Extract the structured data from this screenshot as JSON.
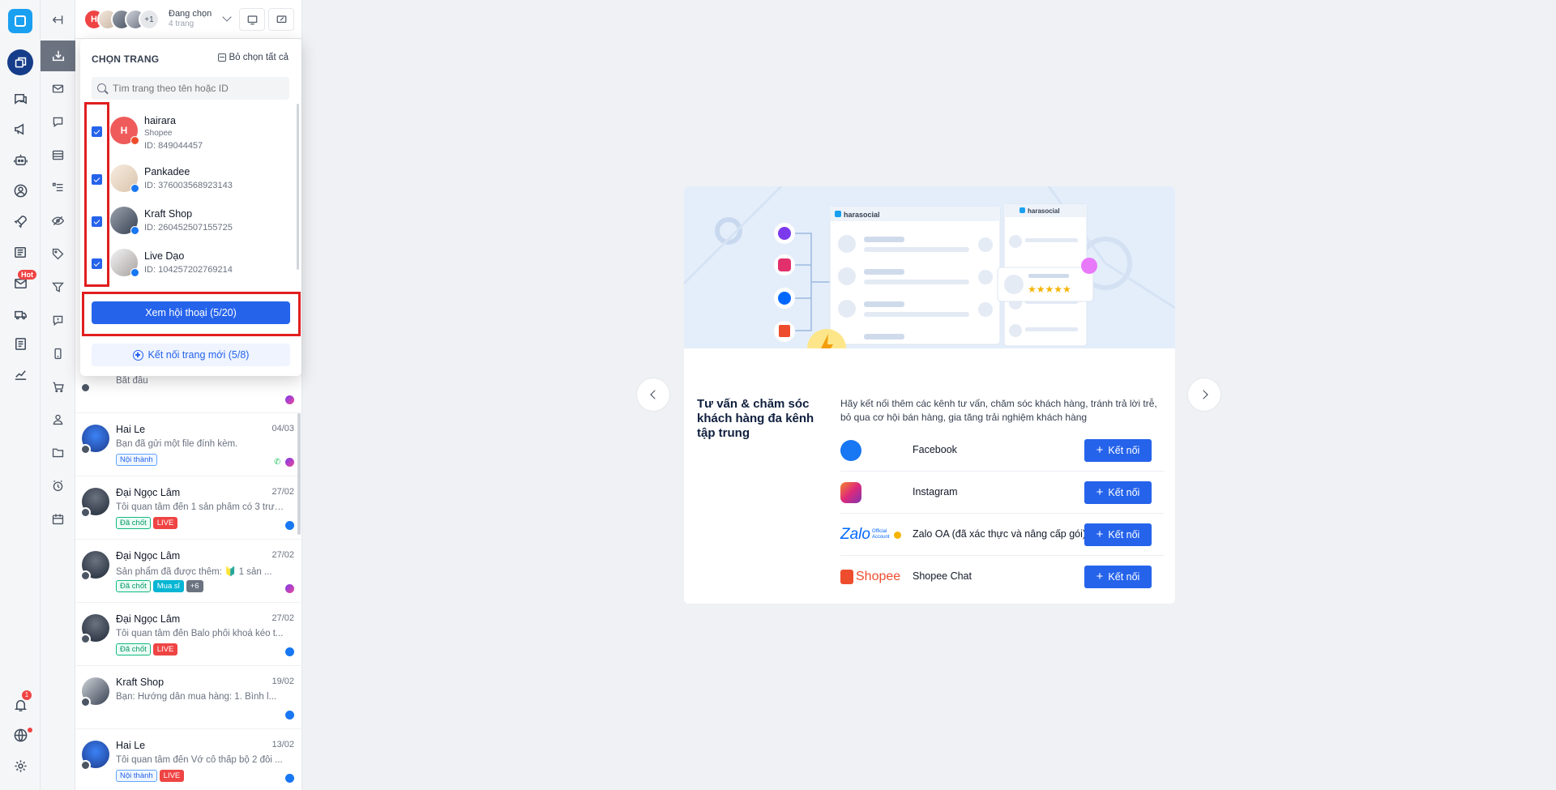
{
  "header": {
    "stack_initial": "H",
    "stack_more": "+1",
    "selection_label": "Đang chọn",
    "selection_count": "4 trang"
  },
  "rail": {
    "hot_badge": "Hot",
    "notification_count": "1"
  },
  "page_picker": {
    "title": "CHỌN TRANG",
    "deselect_all": "Bỏ chọn tất cả",
    "search_placeholder": "Tìm trang theo tên hoặc ID",
    "pages": [
      {
        "name": "hairara",
        "sub": "Shopee",
        "id": "ID: 849044457",
        "initial": "H",
        "checked": true
      },
      {
        "name": "Pankadee",
        "id": "ID: 376003568923143",
        "checked": true
      },
      {
        "name": "Kraft Shop",
        "id": "ID: 260452507155725",
        "checked": true
      },
      {
        "name": "Live Dạo",
        "id": "ID: 104257202769214",
        "checked": true
      }
    ],
    "view_button": "Xem hội thoại (5/20)",
    "connect_button": "Kết nối trang mới (5/8)"
  },
  "conversations": [
    {
      "name": "",
      "date": "",
      "msg": "Bắt đầu",
      "tags": [],
      "channel": "messenger"
    },
    {
      "name": "Hai Le",
      "date": "04/03",
      "msg": "Bạn đã gửi một file đính kèm.",
      "tags": [
        "Nội thành"
      ],
      "channel": "messenger"
    },
    {
      "name": "Đại Ngọc Lâm",
      "date": "27/02",
      "msg": "Tôi quan tâm đến 1 sản phẩm có 3 trườ...",
      "tags": [
        "Đã chốt",
        "LIVE"
      ],
      "channel": "facebook"
    },
    {
      "name": "Đại Ngọc Lâm",
      "date": "27/02",
      "msg": "Sản phẩm đã được thêm: 🔰 1 sản ...",
      "tags": [
        "Đã chốt",
        "Mua sỉ",
        "+6"
      ],
      "channel": "messenger"
    },
    {
      "name": "Đại Ngọc Lâm",
      "date": "27/02",
      "msg": "Tôi quan tâm đến Balo phối khoá kéo t...",
      "tags": [
        "Đã chốt",
        "LIVE"
      ],
      "channel": "facebook"
    },
    {
      "name": "Kraft Shop",
      "date": "19/02",
      "msg": "Bạn: Hướng dẫn mua hàng: 1. Bình l...",
      "tags": [],
      "channel": "facebook"
    },
    {
      "name": "Hai Le",
      "date": "13/02",
      "msg": "Tôi quan tâm đến Vớ cổ thấp bộ 2 đôi ...",
      "tags": [
        "Nội thành",
        "LIVE"
      ],
      "channel": "facebook"
    }
  ],
  "promo": {
    "hero_brand": "harasocial",
    "title": "Tư vấn & chăm sóc khách hàng đa kênh tập trung",
    "description": "Hãy kết nối thêm các kênh tư vấn, chăm sóc khách hàng, tránh trả lời trễ, bỏ qua cơ hội bán hàng, gia tăng trải nghiệm khách hàng",
    "connect_label": "Kết nối",
    "channels": [
      {
        "name": "Facebook",
        "icon": "facebook-icon"
      },
      {
        "name": "Instagram",
        "icon": "instagram-icon"
      },
      {
        "name": "Zalo OA (đã xác thực và nâng cấp gói)",
        "icon": "zalo-oa-logo",
        "logo_text": "Zalo",
        "logo_sub": "Official Account"
      },
      {
        "name": "Shopee Chat",
        "icon": "shopee-logo",
        "logo_text": "Shopee"
      }
    ]
  },
  "colors": {
    "primary": "#2563eb",
    "highlight": "#e01e1e",
    "nav_active": "#163d8a"
  }
}
